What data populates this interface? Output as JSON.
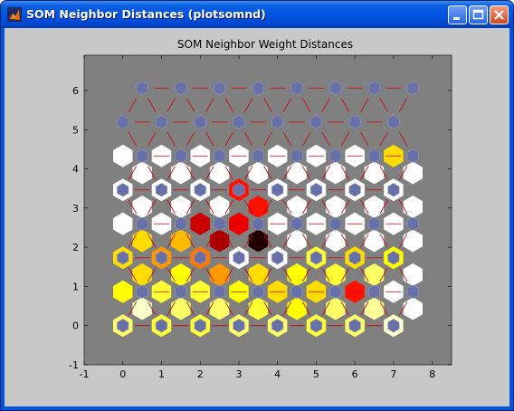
{
  "window": {
    "title": "SOM Neighbor Distances (plotsomnd)"
  },
  "controls": {
    "minimize": "minimize",
    "maximize": "maximize",
    "close": "close"
  },
  "colors": {
    "figure_bg": "#c8c8c8",
    "axes_bg": "#808080",
    "neuron": "#6870a8",
    "line": "#cc0000"
  },
  "chart_data": {
    "type": "heatmap",
    "title": "SOM Neighbor Weight Distances",
    "xlabel": "",
    "ylabel": "",
    "xlim": [
      -1,
      8.5
    ],
    "ylim": [
      -1,
      6.9
    ],
    "xticks": [
      "-1",
      "0",
      "1",
      "2",
      "3",
      "4",
      "5",
      "6",
      "7",
      "8"
    ],
    "yticks": [
      "-1",
      "0",
      "1",
      "2",
      "3",
      "4",
      "5",
      "6"
    ],
    "grid": false,
    "topology": "hexagonal",
    "dimensions": [
      8,
      8
    ],
    "colormap": "hot",
    "neuron_positions": "hex grid: x = col + 0.5*(row mod 2), y = row*0.866",
    "distance_levels": [
      [
        0.85,
        0.8,
        0.8,
        0.85,
        0.85,
        0.8,
        0.85,
        0.95
      ],
      [
        0.95,
        0.85,
        0.85,
        0.8,
        0.75,
        0.85,
        0.9,
        1.0
      ],
      [
        0.75,
        0.8,
        0.8,
        0.75,
        0.7,
        0.7,
        0.4,
        1.0
      ],
      [
        0.7,
        0.75,
        0.6,
        0.7,
        0.75,
        0.8,
        0.85,
        1.0
      ],
      [
        0.7,
        0.6,
        0.55,
        1.0,
        1.0,
        0.8,
        0.7,
        0.75
      ],
      [
        0.7,
        0.65,
        0.25,
        0.05,
        1.0,
        1.0,
        1.0,
        1.0
      ],
      [
        1.0,
        1.0,
        0.3,
        0.35,
        1.0,
        1.0,
        1.0,
        1.0
      ],
      [
        1.0,
        1.0,
        1.0,
        0.4,
        1.0,
        1.0,
        1.0,
        1.0
      ],
      [
        1.0,
        1.0,
        1.0,
        0.4,
        1.0,
        1.0,
        1.0,
        1.0
      ],
      [
        1.0,
        1.0,
        1.0,
        1.0,
        1.0,
        1.0,
        1.0,
        1.0
      ],
      [
        1.0,
        1.0,
        1.0,
        1.0,
        1.0,
        1.0,
        1.0,
        0.7
      ]
    ]
  }
}
